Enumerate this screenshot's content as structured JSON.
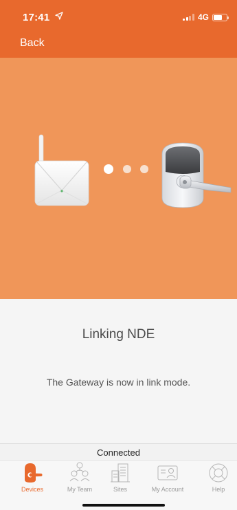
{
  "status_bar": {
    "time": "17:41",
    "network": "4G",
    "location_icon": "location-arrow-icon",
    "signal_icon": "cellular-signal-icon",
    "battery_icon": "battery-icon"
  },
  "navbar": {
    "back_label": "Back"
  },
  "hero": {
    "illustration": "gateway-linking-to-lock",
    "dots_count": 3
  },
  "main": {
    "title": "Linking NDE",
    "message": "The Gateway is now in link mode."
  },
  "connection": {
    "status": "Connected"
  },
  "tabbar": {
    "active_tab": "Devices",
    "tabs": [
      {
        "label": "Devices",
        "icon": "devices-lock-icon",
        "active": true
      },
      {
        "label": "My Team",
        "icon": "team-icon",
        "active": false
      },
      {
        "label": "Sites",
        "icon": "sites-building-icon",
        "active": false
      },
      {
        "label": "My Account",
        "icon": "account-card-icon",
        "active": false
      },
      {
        "label": "Help",
        "icon": "help-lifebuoy-icon",
        "active": false
      }
    ]
  },
  "colors": {
    "brand_orange": "#e8692d",
    "hero_orange": "#f09659",
    "content_bg": "#f5f5f5",
    "inactive_tab": "#9a9a9a"
  }
}
